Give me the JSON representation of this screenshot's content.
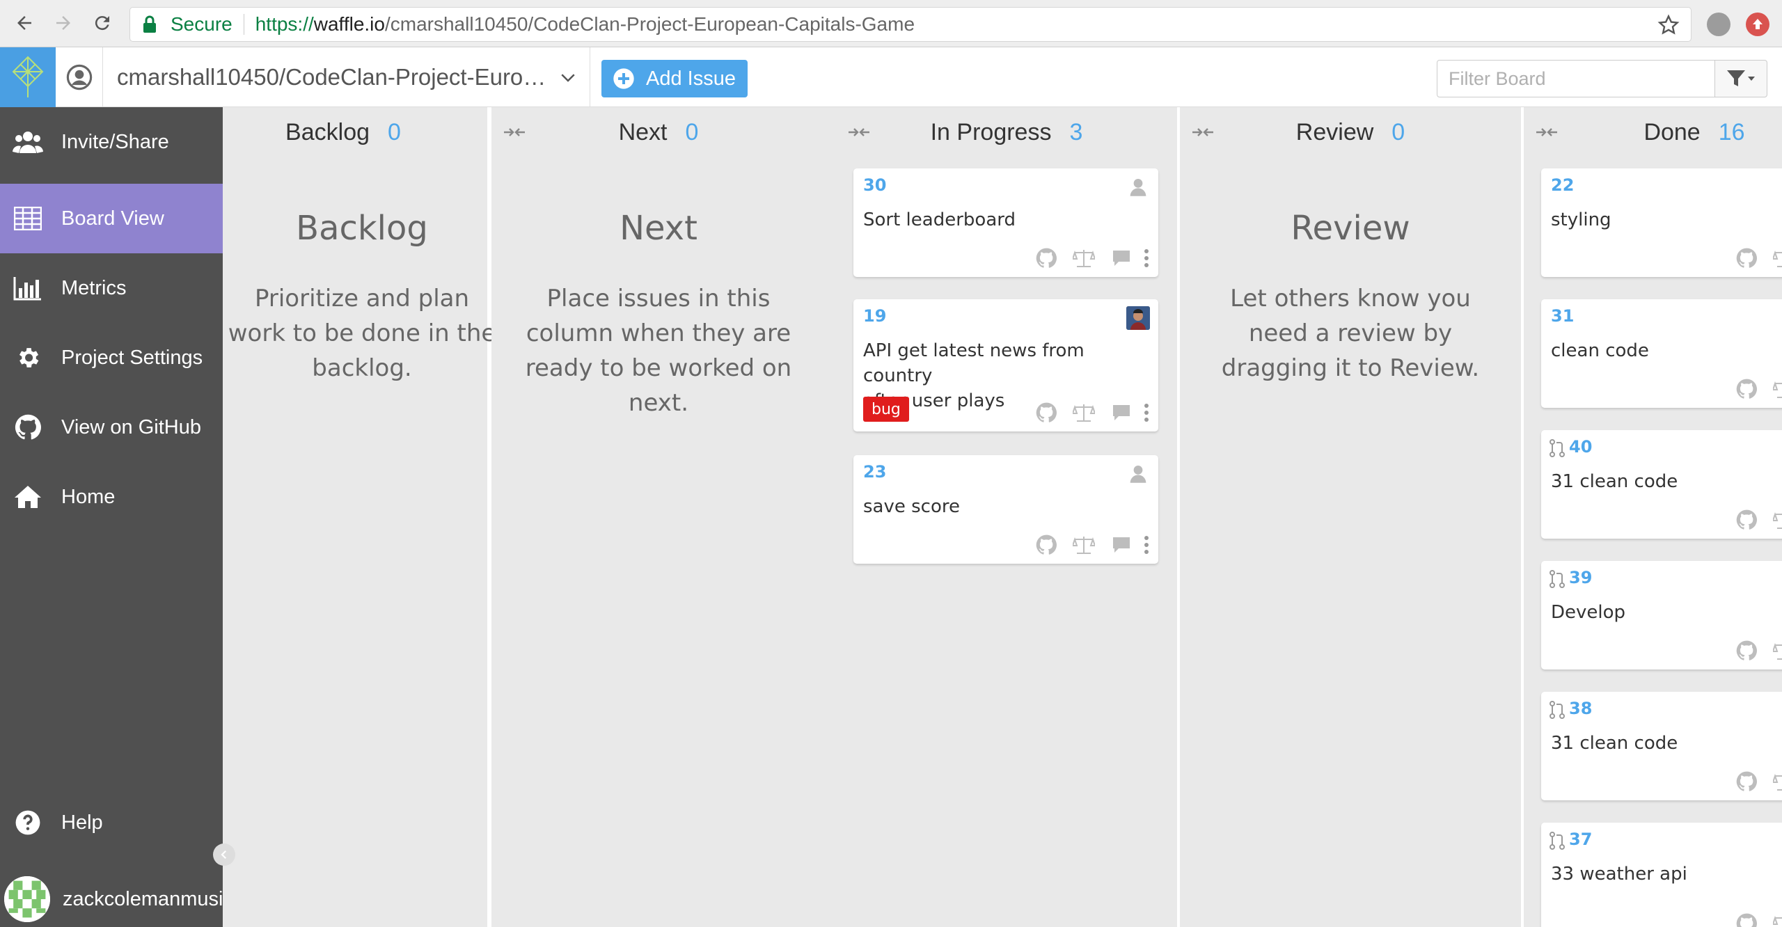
{
  "browser": {
    "secure_label": "Secure",
    "url_proto": "https://",
    "url_host": "waffle.io",
    "url_path": "/cmarshall10450/CodeClan-Project-European-Capitals-Game"
  },
  "header": {
    "repo_name": "cmarshall10450/CodeClan-Project-Euro…",
    "add_issue_label": "Add Issue",
    "filter_placeholder": "Filter Board"
  },
  "sidebar": {
    "items": [
      {
        "label": "Invite/Share",
        "icon": "users-icon"
      },
      {
        "label": "Board View",
        "icon": "table-icon",
        "active": true
      },
      {
        "label": "Metrics",
        "icon": "bar-chart-icon"
      },
      {
        "label": "Project Settings",
        "icon": "gear-icon"
      },
      {
        "label": "View on GitHub",
        "icon": "github-icon"
      },
      {
        "label": "Home",
        "icon": "home-icon"
      }
    ],
    "help_label": "Help",
    "username": "zackcolemanmusic"
  },
  "columns": [
    {
      "name": "Backlog",
      "count": "0",
      "empty_title": "Backlog",
      "empty_lines": [
        "Prioritize and plan",
        "work to be done in the",
        "backlog."
      ]
    },
    {
      "name": "Next",
      "count": "0",
      "empty_title": "Next",
      "empty_lines": [
        "Place issues in this",
        "column when they are",
        "ready to be worked on",
        "next."
      ]
    },
    {
      "name": "In Progress",
      "count": "3",
      "cards": [
        {
          "number": "30",
          "title": "Sort leaderboard"
        },
        {
          "number": "19",
          "title_lines": [
            "API get latest news from country",
            "after user plays"
          ],
          "label": "bug"
        },
        {
          "number": "23",
          "title": "save score"
        }
      ]
    },
    {
      "name": "Review",
      "count": "0",
      "empty_title": "Review",
      "empty_lines": [
        "Let others know you",
        "need a review by",
        "dragging it to Review."
      ]
    },
    {
      "name": "Done",
      "count": "16",
      "cards": [
        {
          "number": "22",
          "title": "styling"
        },
        {
          "number": "31",
          "title": "clean code"
        },
        {
          "number": "40",
          "title": "31 clean code"
        },
        {
          "number": "39",
          "title": "Develop"
        },
        {
          "number": "38",
          "title": "31 clean code"
        },
        {
          "number": "37",
          "title": "33 weather api"
        }
      ]
    }
  ],
  "colors": {
    "accent": "#4ea6ea",
    "sidebar_bg": "#505050",
    "sidebar_active": "#8f83cf",
    "bug_label": "#e01d1d"
  }
}
